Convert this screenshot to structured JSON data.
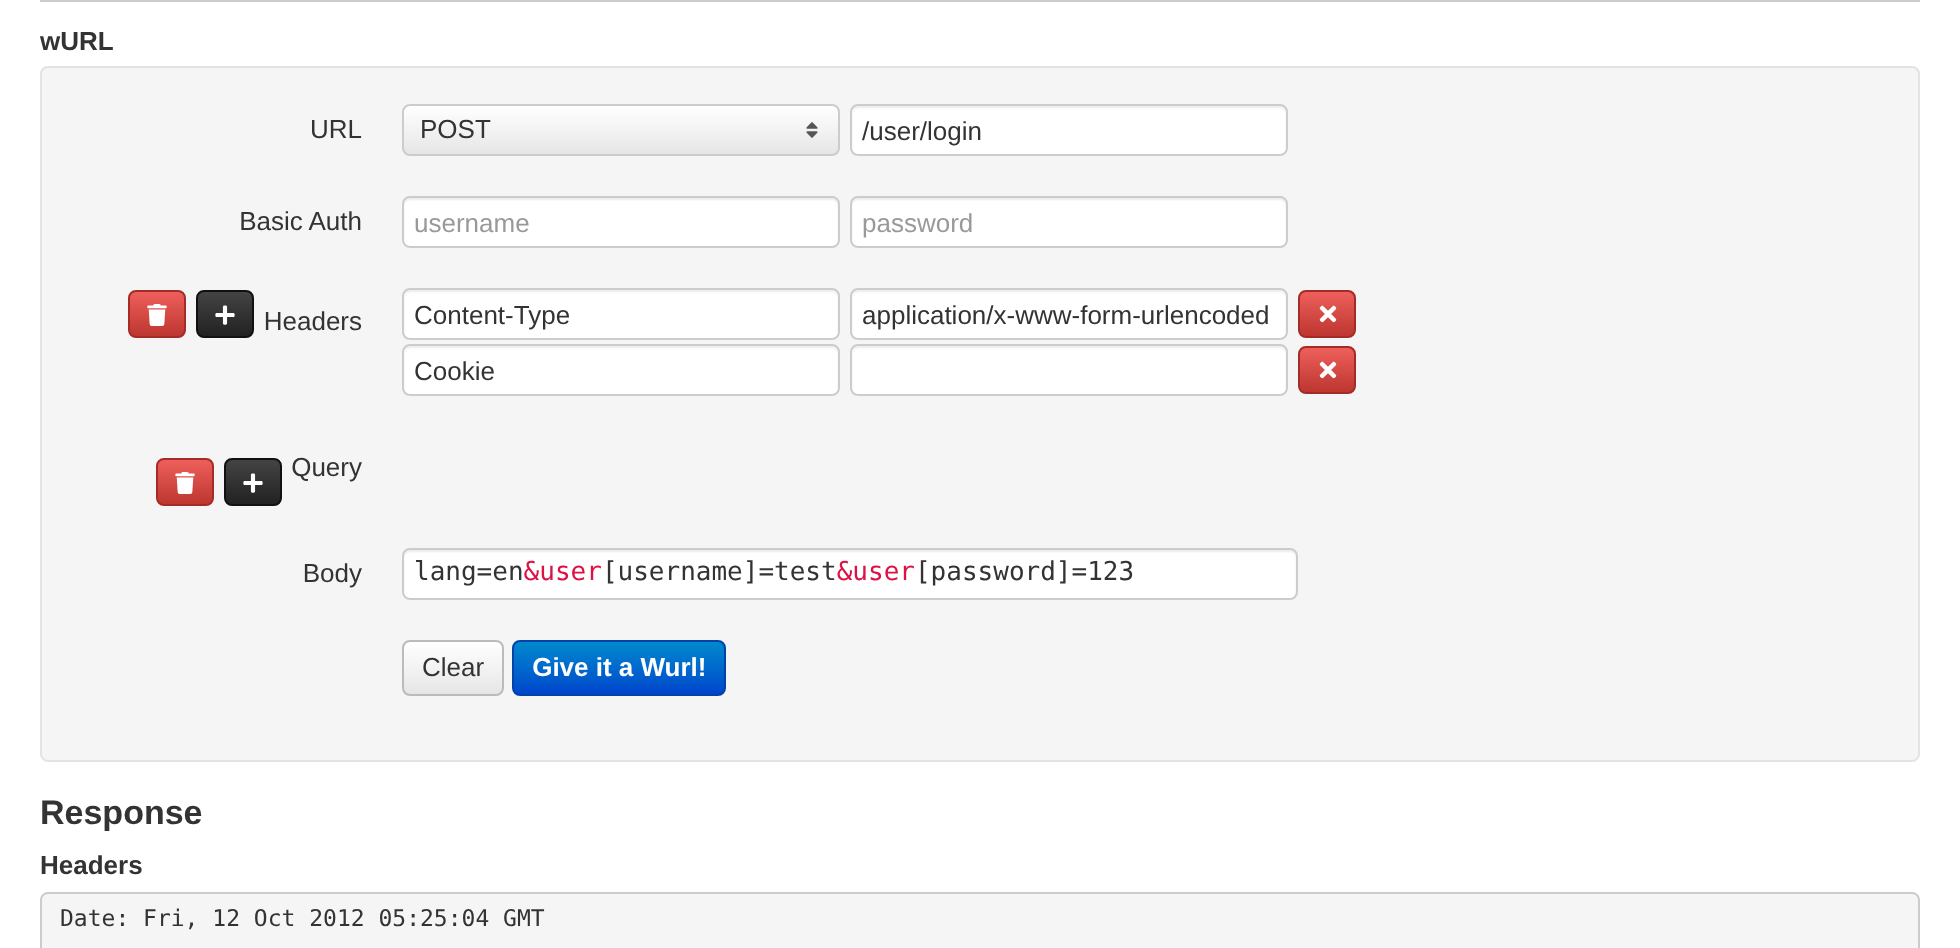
{
  "section_title": "wURL",
  "url": {
    "label": "URL",
    "method": "POST",
    "path": "/user/login"
  },
  "basic_auth": {
    "label": "Basic Auth",
    "username_placeholder": "username",
    "password_placeholder": "password"
  },
  "headers": {
    "label": "Headers",
    "rows": [
      {
        "name": "Content-Type",
        "value": "application/x-www-form-urlencoded"
      },
      {
        "name": "Cookie"
      }
    ]
  },
  "query": {
    "label": "Query"
  },
  "body": {
    "label": "Body",
    "segments": [
      {
        "text": "lang=en",
        "highlight": false
      },
      {
        "text": "&user",
        "highlight": true
      },
      {
        "text": "[username]=test",
        "highlight": false
      },
      {
        "text": "&user",
        "highlight": true
      },
      {
        "text": "[password]=123",
        "highlight": false
      }
    ]
  },
  "buttons": [
    {
      "label": "Clear",
      "kind": "default"
    },
    {
      "label": "Give it a Wurl!",
      "kind": "primary"
    }
  ],
  "response": {
    "title": "Response",
    "headers_title": "Headers",
    "header_lines": [
      "Date: Fri, 12 Oct 2012 05:25:04 GMT"
    ]
  }
}
